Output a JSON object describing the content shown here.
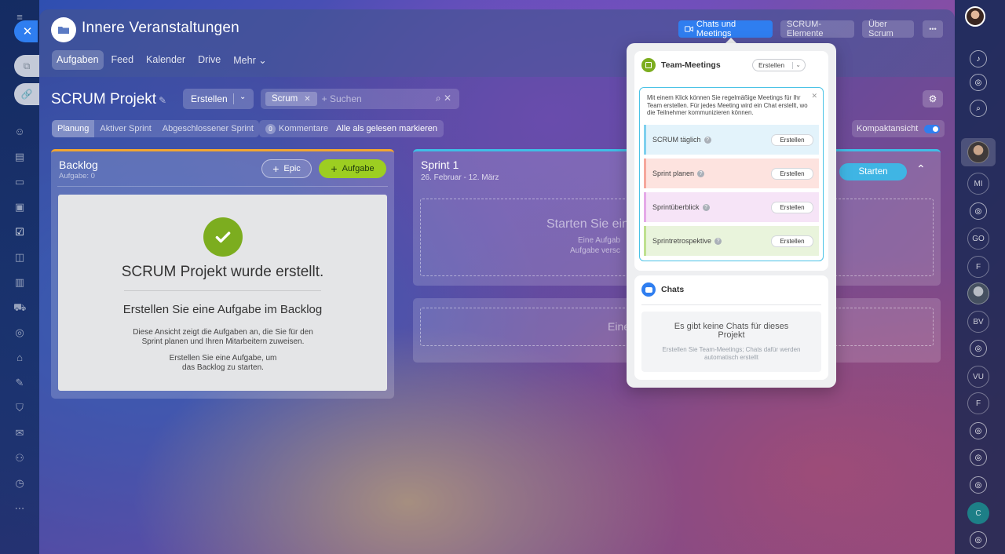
{
  "header": {
    "project_title": "Innere Veranstaltungen",
    "subnav": [
      "Aufgaben",
      "Feed",
      "Kalender",
      "Drive",
      "Mehr ⌄"
    ],
    "buttons": {
      "chats_meetings": "Chats und Meetings",
      "scrum_elements": "SCRUM-Elemente",
      "about_scrum": "Über Scrum",
      "more": "•••"
    }
  },
  "toolbar": {
    "title": "SCRUM Projekt",
    "create": "Erstellen",
    "filter_chip": "Scrum",
    "search_placeholder": "+ Suchen"
  },
  "tabs": [
    "Planung",
    "Aktiver Sprint",
    "Abgeschlossener Sprint"
  ],
  "comments": {
    "count": "0",
    "label": "Kommentare",
    "mark_all": "Alle als gelesen markieren"
  },
  "compact_view": "Kompaktansicht",
  "backlog": {
    "title": "Backlog",
    "subtitle": "Aufgabe: 0",
    "epic_btn": "Epic",
    "task_btn": "Aufgabe",
    "card_title": "SCRUM Projekt wurde erstellt.",
    "card_sub": "Erstellen Sie eine Aufgabe im Backlog",
    "card_text1a": "Diese Ansicht zeigt die Aufgaben an, die Sie für den",
    "card_text1b": "Sprint planen und Ihren Mitarbeitern zuweisen.",
    "card_text2a": "Erstellen Sie eine Aufgabe, um",
    "card_text2b": "das Backlog zu starten."
  },
  "sprint": {
    "title": "Sprint 1",
    "dates": "26. Februar - 12. März",
    "start_btn": "Starten",
    "dashed_title": "Starten Sie ein",
    "dashed_sub1": "Eine Aufgab",
    "dashed_sub2": "Aufgabe versc",
    "dashed2_title": "Eine"
  },
  "popup": {
    "meetings_title": "Team-Meetings",
    "meetings_create": "Erstellen",
    "info_text": "Mit einem Klick können Sie regelmäßige Meetings für Ihr Team erstellen. Für jedes Meeting wird ein Chat erstellt, wo die Teilnehmer kommunizieren können.",
    "meetings": [
      {
        "label": "SCRUM täglich",
        "btn": "Erstellen"
      },
      {
        "label": "Sprint planen",
        "btn": "Erstellen"
      },
      {
        "label": "Sprintüberblick",
        "btn": "Erstellen"
      },
      {
        "label": "Sprintretrospektive",
        "btn": "Erstellen"
      }
    ],
    "chats_title": "Chats",
    "chats_empty_title": "Es gibt keine Chats für dieses Projekt",
    "chats_empty_sub": "Erstellen Sie Team-Meetings; Chats dafür werden automatisch erstellt"
  },
  "right_rail": {
    "avatars": [
      "MI",
      "GO",
      "F",
      "BV",
      "VU",
      "F",
      "C"
    ]
  },
  "colors": {
    "accent": "#2f7ef0",
    "green": "#9dce21",
    "backlog_border": "#f2a531",
    "sprint_border": "#3fbde6",
    "meeting_daily": "#e3f3fb",
    "meeting_planning": "#fde3df",
    "meeting_review": "#f6e4f7",
    "meeting_retro": "#e9f4dc"
  }
}
